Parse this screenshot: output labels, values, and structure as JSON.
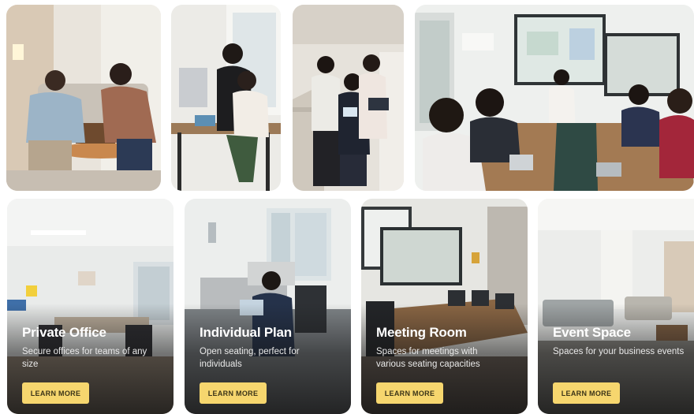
{
  "gallery": {
    "photos": [
      {
        "alt": "Coworking lounge"
      },
      {
        "alt": "Desk area"
      },
      {
        "alt": "Team collaboration"
      },
      {
        "alt": "Meeting presentation"
      }
    ]
  },
  "services": [
    {
      "title": "Private Office",
      "description": "Secure offices for teams of any size",
      "cta": "LEARN MORE"
    },
    {
      "title": "Individual Plan",
      "description": "Open seating, perfect for individuals",
      "cta": "LEARN MORE"
    },
    {
      "title": "Meeting Room",
      "description": "Spaces for meetings with various seating capacities",
      "cta": "LEARN MORE"
    },
    {
      "title": "Event Space",
      "description": "Spaces for your business events",
      "cta": "LEARN MORE"
    }
  ],
  "colors": {
    "button_bg": "#f6d66e",
    "button_text": "#3b3418",
    "title_text": "#ffffff"
  }
}
